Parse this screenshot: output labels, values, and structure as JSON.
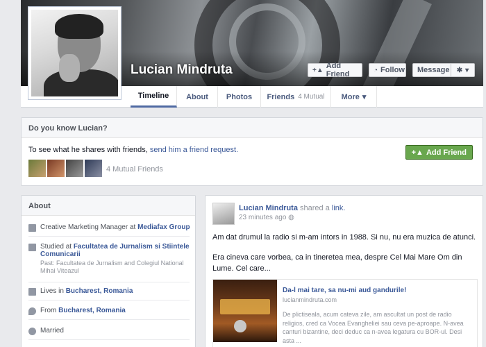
{
  "profile": {
    "name": "Lucian Mindruta"
  },
  "cover_buttons": {
    "add_friend": "Add Friend",
    "follow": "Follow",
    "message": "Message"
  },
  "nav": {
    "tabs": [
      {
        "label": "Timeline"
      },
      {
        "label": "About"
      },
      {
        "label": "Photos"
      },
      {
        "label": "Friends",
        "sub": "4 Mutual"
      },
      {
        "label": "More"
      }
    ]
  },
  "know_box": {
    "title": "Do you know Lucian?",
    "message_prefix": "To see what he shares with friends,",
    "message_link": "send him a friend request.",
    "add_friend_label": "Add Friend",
    "mutual_friends": "4 Mutual Friends"
  },
  "about": {
    "title": "About",
    "work": {
      "prefix": "Creative Marketing Manager at",
      "link": "Mediafax Group"
    },
    "study": {
      "prefix": "Studied at",
      "link": "Facultatea de Jurnalism si Stiintele Comunicarii",
      "past": "Past: Facultatea de Jurnalism and Colegiul National Mihai Viteazul"
    },
    "lives": {
      "prefix": "Lives in",
      "link": "Bucharest, Romania"
    },
    "from": {
      "prefix": "From",
      "link": "Bucharest, Romania"
    },
    "relationship": "Married"
  },
  "post": {
    "author": "Lucian Mindruta",
    "action": "shared a",
    "action_link": "link.",
    "time": "23 minutes ago",
    "text1": "Am dat drumul la radio si m-am intors in 1988. Si nu, nu era muzica de atunci.",
    "text2": "Era cineva care vorbea, ca in tineretea mea, despre Cel Mai Mare Om din Lume. Cel care...",
    "link_card": {
      "title": "Da-l mai tare, sa nu-mi aud gandurile!",
      "url": "lucianmindruta.com",
      "description": "De plictiseala, acum cateva zile, am ascultat un post de radio religios, cred ca Vocea Evangheliei sau ceva pe-aproape. N-avea canturi bizantine, deci deduc ca n-avea legatura cu BOR-ul. Desi asta ..."
    }
  },
  "colors": {
    "link_blue": "#3b5998",
    "add_friend_green": "#69a74e",
    "page_bg": "#e9eaed"
  }
}
